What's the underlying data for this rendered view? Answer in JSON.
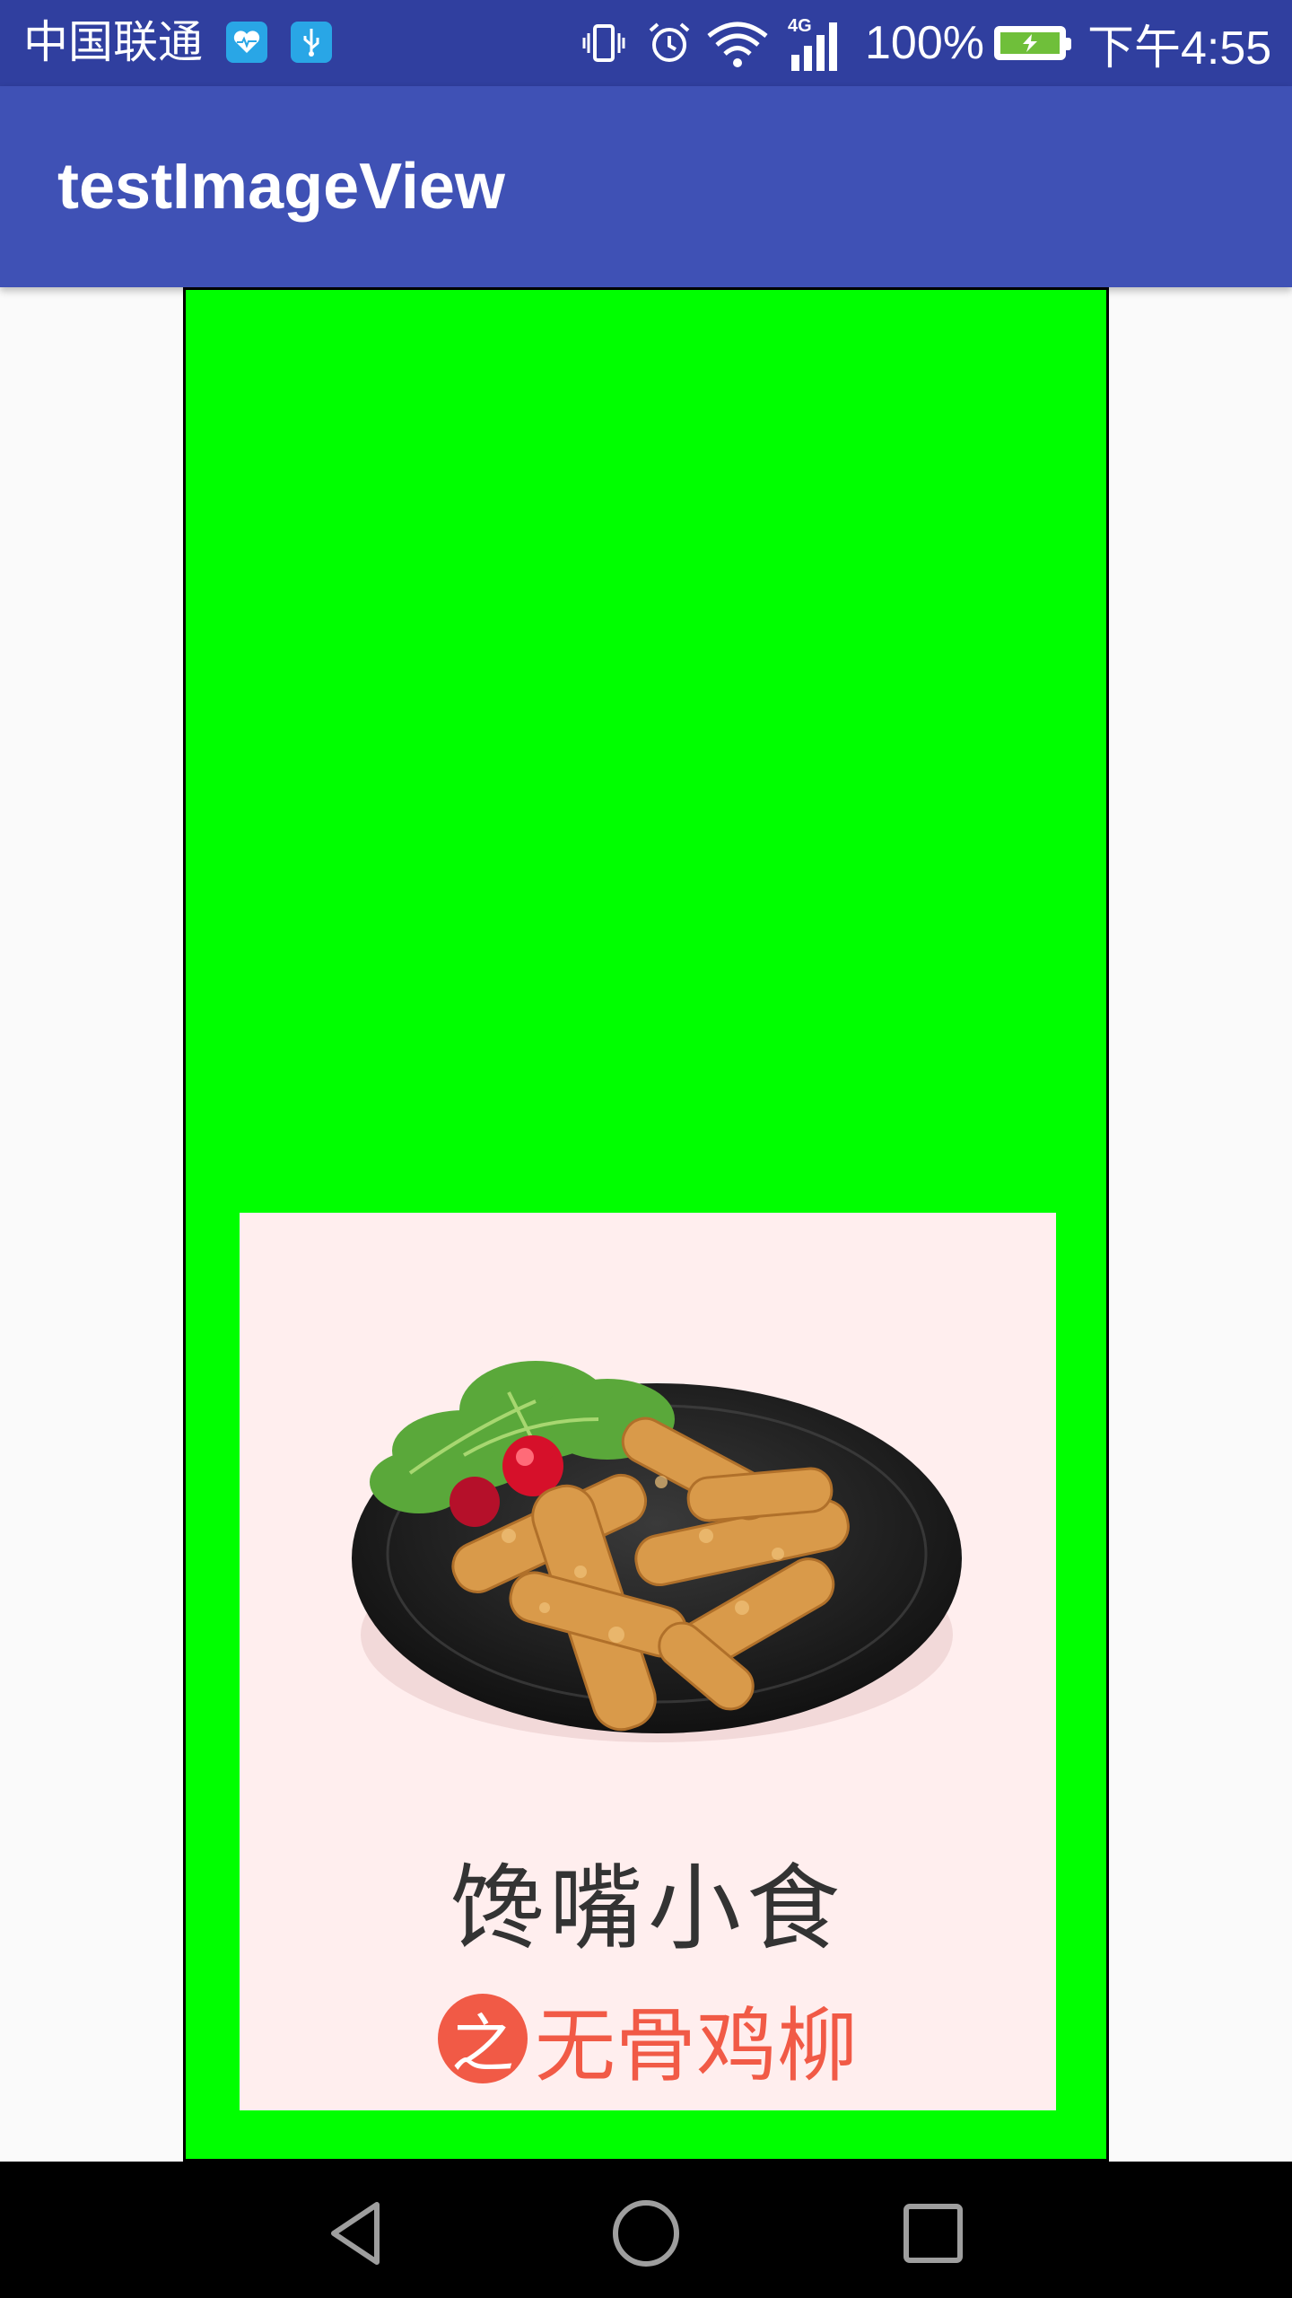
{
  "status_bar": {
    "carrier": "中国联通",
    "battery": "100%",
    "time": "下午4:55",
    "network": "4G",
    "icons": [
      "health-icon",
      "usb-icon",
      "vibrate-icon",
      "alarm-icon",
      "wifi-icon",
      "signal-icon",
      "battery-icon"
    ]
  },
  "app_bar": {
    "title": "testImageView"
  },
  "image_view": {
    "background_color": "#00ff00",
    "card": {
      "background_color": "#ffeeee",
      "title": "馋嘴小食",
      "badge": "之",
      "subtitle": "无骨鸡柳",
      "accent_color": "#f15a46"
    }
  },
  "nav_bar": {
    "buttons": [
      "back-icon",
      "home-icon",
      "recents-icon"
    ]
  }
}
